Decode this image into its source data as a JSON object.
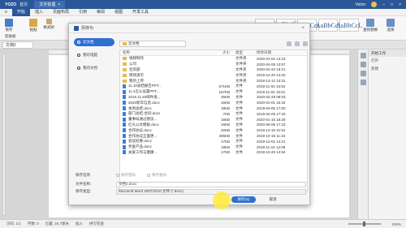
{
  "titlebar": {
    "logo": "YOZO",
    "home": "首页",
    "doc_tab": "文字处理",
    "close": "×",
    "user": "Victor"
  },
  "menu": [
    "开始",
    "插入",
    "页面布局",
    "引用",
    "审阅",
    "视图",
    "开发工具"
  ],
  "ribbon": {
    "save": "保存",
    "paste": "粘贴",
    "format_brush": "格式刷",
    "clipboard": "剪贴板",
    "styles": [
      "AaBbCcD",
      "AaBbCc",
      "AaBbCcI",
      "AaBbCcI",
      "AaBbCcL"
    ],
    "find_replace": "查找替换",
    "select": "选择"
  },
  "docstrip": {
    "tab": "文档2"
  },
  "right_panel": {
    "header": "开始工作",
    "open": "打开",
    "new": "新建"
  },
  "status": {
    "page": "页码: 1/1",
    "words": "字数: 0",
    "pos": "位置: 25.7厘米",
    "insert": "插入",
    "spell": "拼写检查",
    "zoom": "100%"
  },
  "dialog": {
    "title": "另存为",
    "close": "×",
    "places": [
      "云文档",
      "我的电脑",
      "我的文档"
    ],
    "path": "云文档",
    "columns": {
      "name": "名称",
      "size": "大小",
      "type": "类型",
      "date": "修改日期"
    },
    "files": [
      {
        "icon": "folder",
        "name": "视频制作",
        "size": "",
        "type": "文件夹",
        "date": "2020-01-02 13:15"
      },
      {
        "icon": "folder",
        "name": "公司",
        "size": "",
        "type": "文件夹",
        "date": "2020-04-05 13:57"
      },
      {
        "icon": "folder",
        "name": "合资部",
        "size": "",
        "type": "文件夹",
        "date": "2020-04-22 18:21"
      },
      {
        "icon": "folder",
        "name": "转场演示",
        "size": "",
        "type": "文件夹",
        "date": "2019-12-20 14:20"
      },
      {
        "icon": "folder",
        "name": "我的上传",
        "size": "",
        "type": "文件夹",
        "date": "2019-12-12 10:31"
      },
      {
        "icon": "doc",
        "name": "11.10总结报告PPT...",
        "size": "571KB",
        "type": "文件",
        "date": "2019-11-04 15:54"
      },
      {
        "icon": "doc",
        "name": "11.4怎么设置PPT...",
        "size": "157KB",
        "type": "文件",
        "date": "2019-11-04 15:51"
      },
      {
        "icon": "doc",
        "name": "2019.11.20邮件发...",
        "size": "35KB",
        "type": "文件",
        "date": "2020-02-28 09:03"
      },
      {
        "icon": "doc",
        "name": "2020新年信息.docx",
        "size": "16KB",
        "type": "文件",
        "date": "2020-01-01 16:34"
      },
      {
        "icon": "doc",
        "name": "本周总结.docx",
        "size": "18KB",
        "type": "文件",
        "date": "2019-04-05 17:00"
      },
      {
        "icon": "doc",
        "name": "部门总结-合同.docx",
        "size": "7KB",
        "type": "文件",
        "date": "2019-04-05 17:33"
      },
      {
        "icon": "doc",
        "name": "董事局通过建议...",
        "size": "16KB",
        "type": "文件",
        "date": "2020-01-15 16:28"
      },
      {
        "icon": "doc",
        "name": "红头公文模板.docx",
        "size": "16KB",
        "type": "文件",
        "date": "2020-05-06 17:23"
      },
      {
        "icon": "doc",
        "name": "合作协议.docx",
        "size": "32KB",
        "type": "文件",
        "date": "2019-12-15 21:51"
      },
      {
        "icon": "doc",
        "name": "合作协议正面更...",
        "size": "406KB",
        "type": "文件",
        "date": "2019-10-15 11:43"
      },
      {
        "icon": "doc",
        "name": "会议纪要.docx",
        "size": "17KB",
        "type": "文件",
        "date": "2019-12-01 14:21"
      },
      {
        "icon": "doc",
        "name": "奖金产品.docx",
        "size": "18KB",
        "type": "文件",
        "date": "2019-11-15 12:09"
      },
      {
        "icon": "doc",
        "name": "关爱工作与健康...",
        "size": "17KB",
        "type": "文件",
        "date": "2019-10-29 13:54"
      }
    ],
    "save_options_label": "保存选项",
    "opt_password": "保存密码",
    "opt_backup": "保存备份",
    "filename_label": "文件名称:",
    "filename": "文档2.docx",
    "filetype_label": "保存类型:",
    "filetype": "Microsoft Word 2007/2010 文件 (*.docx)",
    "save_btn": "保存(S)",
    "cancel_btn": "取消"
  }
}
